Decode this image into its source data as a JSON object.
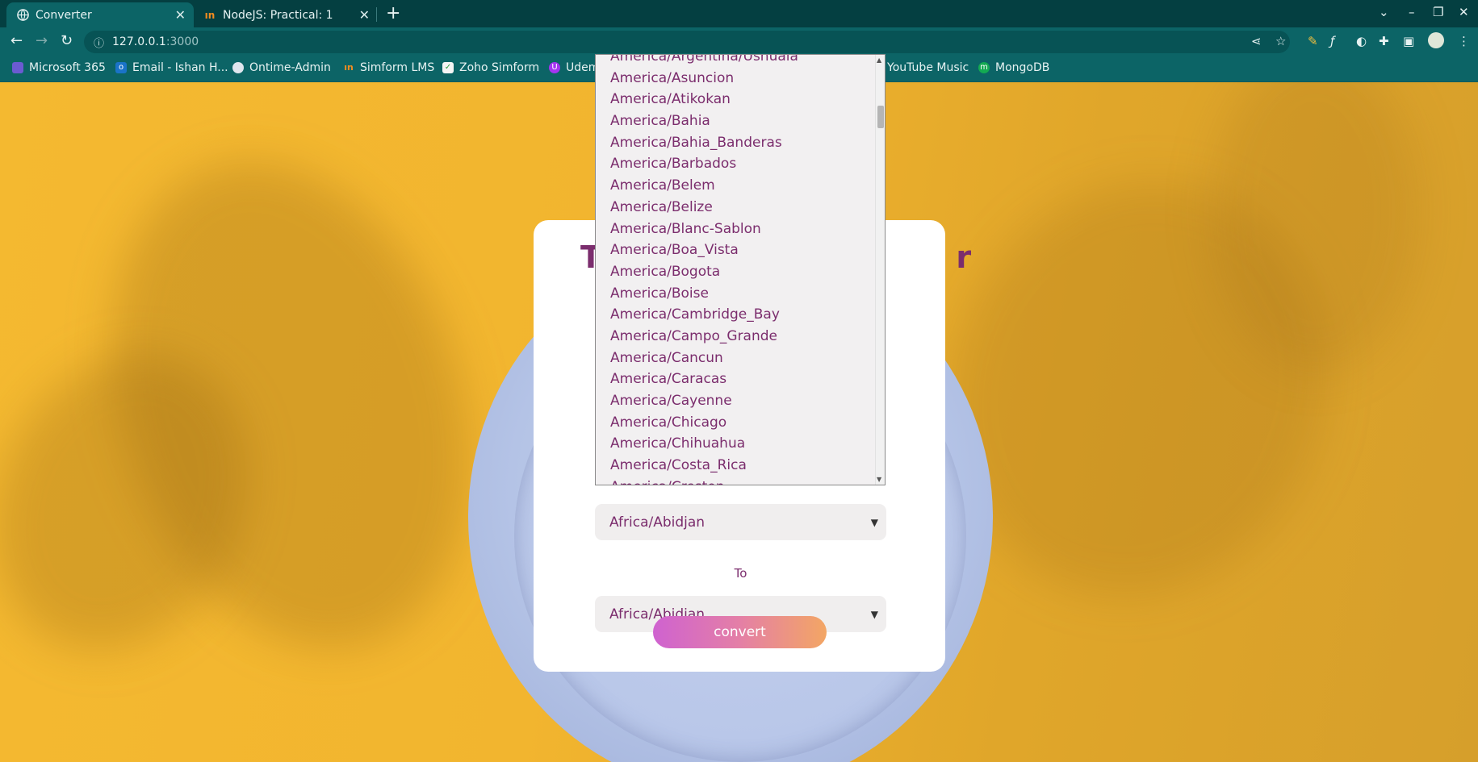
{
  "tabs": [
    {
      "title": "Converter",
      "icon": "globe-icon",
      "active": true
    },
    {
      "title": "NodeJS: Practical: 1",
      "icon": "simform-icon",
      "active": false
    }
  ],
  "address": {
    "host": "127.0.0.1",
    "port": ":3000"
  },
  "bookmarks": [
    {
      "label": "Microsoft 365",
      "icon": "microsoft365-icon",
      "color": "#6b5bd2"
    },
    {
      "label": "Email - Ishan H...",
      "icon": "outlook-icon",
      "color": "#1a73c8"
    },
    {
      "label": "Ontime-Admin",
      "icon": "ontime-icon",
      "color": "#dfe6ee"
    },
    {
      "label": "Simform LMS",
      "icon": "simform-icon",
      "color": "#f28c1f"
    },
    {
      "label": "Zoho Simform",
      "icon": "zoho-icon",
      "color": "#f5f5f5"
    },
    {
      "label": "Udem",
      "icon": "udemy-icon",
      "color": "#a435f0"
    },
    {
      "label": "YouTube Music",
      "icon": "youtube-music-icon",
      "color": "#ff0000"
    },
    {
      "label": "MongoDB",
      "icon": "mongodb-icon",
      "color": "#13aa52"
    }
  ],
  "card": {
    "title_left": "T",
    "title_right": "r",
    "from_value": "Africa/Abidjan",
    "to_label": "To",
    "to_value": "Africa/Abidjan",
    "convert_label": "convert"
  },
  "dropdown": {
    "items": [
      "America/Argentina/Ushuaia",
      "America/Asuncion",
      "America/Atikokan",
      "America/Bahia",
      "America/Bahia_Banderas",
      "America/Barbados",
      "America/Belem",
      "America/Belize",
      "America/Blanc-Sablon",
      "America/Boa_Vista",
      "America/Bogota",
      "America/Boise",
      "America/Cambridge_Bay",
      "America/Campo_Grande",
      "America/Cancun",
      "America/Caracas",
      "America/Cayenne",
      "America/Chicago",
      "America/Chihuahua",
      "America/Costa_Rica",
      "America/Creston"
    ]
  }
}
